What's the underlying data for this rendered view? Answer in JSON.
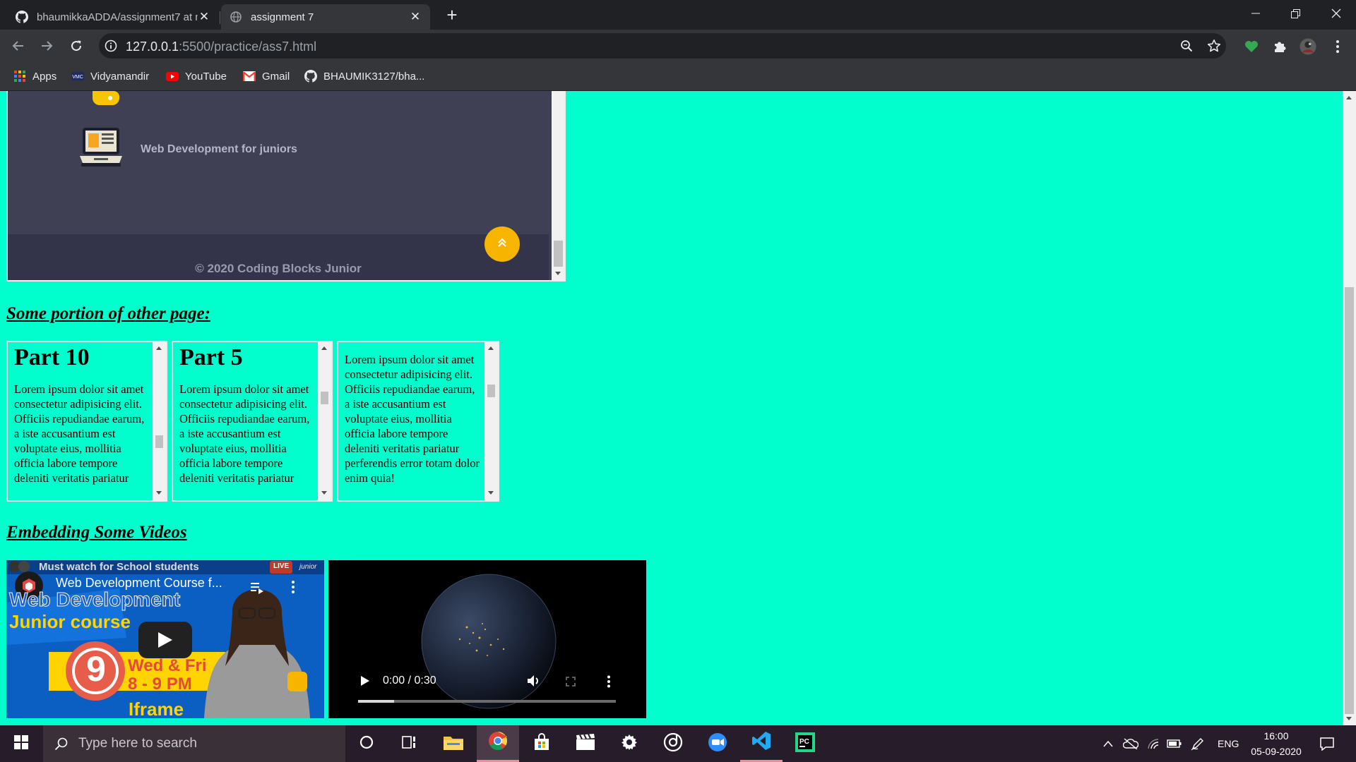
{
  "browser": {
    "tabs": [
      {
        "title": "bhaumikkaADDA/assignment7 at master",
        "active": false
      },
      {
        "title": "assignment 7",
        "active": true
      }
    ],
    "url_host": "127.0.0.1",
    "url_path": ":5500/practice/ass7.html",
    "bookmarks": [
      {
        "label": "Apps",
        "icon": "apps-grid-icon"
      },
      {
        "label": "Vidyamandir",
        "icon": "vidyamandir-logo-icon"
      },
      {
        "label": "YouTube",
        "icon": "youtube-icon"
      },
      {
        "label": "Gmail",
        "icon": "gmail-icon"
      },
      {
        "label": "BHAUMIK3127/bha...",
        "icon": "github-icon"
      }
    ]
  },
  "embedded_site": {
    "course_label": "Web Development for juniors",
    "copyright": "© 2020 Coding Blocks Junior",
    "accent_color": "#f7b500"
  },
  "sections": {
    "other_page_heading": "Some portion of other page:",
    "videos_heading": "Embedding Some Videos"
  },
  "mini_frames": [
    {
      "heading": "Part 10",
      "text": "Lorem ipsum dolor sit amet consectetur adipisicing elit. Officiis repudiandae earum, a iste accusantium est voluptate eius, mollitia officia labore tempore deleniti veritatis pariatur"
    },
    {
      "heading": "Part 5",
      "text": "Lorem ipsum dolor sit amet consectetur adipisicing elit. Officiis repudiandae earum, a iste accusantium est voluptate eius, mollitia officia labore tempore deleniti veritatis pariatur"
    },
    {
      "heading": "",
      "text": "Lorem ipsum dolor sit amet consectetur adipisicing elit. Officiis repudiandae earum, a iste accusantium est voluptate eius, mollitia officia labore tempore deleniti veritatis pariatur perferendis error totam dolor enim quia!"
    }
  ],
  "youtube_embed": {
    "banner": "Must watch for School students",
    "title": "Web Development Course f...",
    "thumb_line1": "Web Development",
    "thumb_line2": "Junior course",
    "number": "9",
    "schedule_days": "Wed & Fri",
    "schedule_time": "8 - 9 PM",
    "caption": "Iframe",
    "badge_live": "LIVE",
    "badge_junior": "junior"
  },
  "video_player": {
    "time": "0:00 / 0:30",
    "progress": 0.14
  },
  "taskbar": {
    "search_placeholder": "Type here to search",
    "language": "ENG",
    "time": "16:00",
    "date": "05-09-2020"
  },
  "colors": {
    "page_background": "#00ffcc",
    "chrome_dark": "#202124",
    "chrome_toolbar": "#35363a"
  }
}
